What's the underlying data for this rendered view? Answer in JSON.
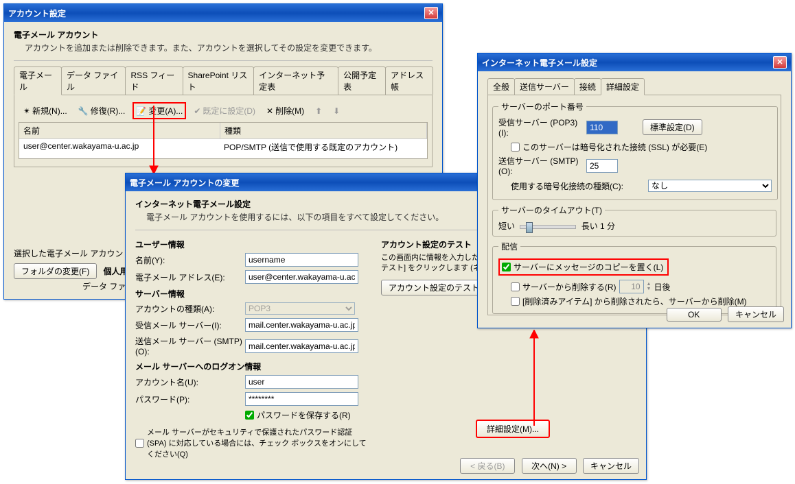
{
  "win1": {
    "title": "アカウント設定",
    "header": "電子メール アカウント",
    "sub": "アカウントを追加または削除できます。また、アカウントを選択してその設定を変更できます。",
    "tabs": [
      "電子メール",
      "データ ファイル",
      "RSS フィード",
      "SharePoint リスト",
      "インターネット予定表",
      "公開予定表",
      "アドレス帳"
    ],
    "toolbar": {
      "new": "新規(N)...",
      "repair": "修復(R)...",
      "change": "変更(A)...",
      "default": "既定に設定(D)",
      "remove": "削除(M)"
    },
    "cols": [
      "名前",
      "種類"
    ],
    "row": {
      "name": "user@center.wakayama-u.ac.jp",
      "type": "POP/SMTP (送信で使用する既定のアカウント)"
    },
    "selectedText": "選択した電子メール アカウントでは",
    "folderBtn": "フォルダの変更(F)",
    "personal": "個人用フ",
    "dataFile": "データ ファ"
  },
  "win2": {
    "title": "電子メール アカウントの変更",
    "header": "インターネット電子メール設定",
    "sub": "電子メール アカウントを使用するには、以下の項目をすべて設定してください。",
    "secUser": "ユーザー情報",
    "nameLbl": "名前(Y):",
    "nameVal": "username",
    "emailLbl": "電子メール アドレス(E):",
    "emailVal": "user@center.wakayama-u.ac",
    "secServer": "サーバー情報",
    "acctTypeLbl": "アカウントの種類(A):",
    "acctTypeVal": "POP3",
    "inSrvLbl": "受信メール サーバー(I):",
    "inSrvVal": "mail.center.wakayama-u.ac.jp",
    "outSrvLbl": "送信メール サーバー (SMTP)(O):",
    "outSrvVal": "mail.center.wakayama-u.ac.jp",
    "secLogon": "メール サーバーへのログオン情報",
    "userLbl": "アカウント名(U):",
    "userVal": "user",
    "pwLbl": "パスワード(P):",
    "pwVal": "********",
    "savePw": "パスワードを保存する(R)",
    "spa": "メール サーバーがセキュリティで保護されたパスワード認証 (SPA) に対応している場合には、チェック ボックスをオンにしてください(Q)",
    "testHeader": "アカウント設定のテスト",
    "testText": "この画面内に情報を入力したら、ことをお勧めします。テストを実行定のテスト] をクリックします (ネッ必要があります)。",
    "testBtn": "アカウント設定のテスト(T)",
    "advBtn": "詳細設定(M)...",
    "back": "< 戻る(B)",
    "next": "次へ(N) >",
    "cancel": "キャンセル"
  },
  "win3": {
    "title": "インターネット電子メール設定",
    "tabs": [
      "全般",
      "送信サーバー",
      "接続",
      "詳細設定"
    ],
    "portSec": "サーバーのポート番号",
    "pop3Lbl": "受信サーバー (POP3)(I):",
    "pop3Val": "110",
    "stdBtn": "標準設定(D)",
    "sslChk": "このサーバーは暗号化された接続 (SSL) が必要(E)",
    "smtpLbl": "送信サーバー (SMTP)(O):",
    "smtpVal": "25",
    "encLbl": "使用する暗号化接続の種類(C):",
    "encVal": "なし",
    "timeoutSec": "サーバーのタイムアウト(T)",
    "short": "短い",
    "long": "長い 1 分",
    "delivSec": "配信",
    "leaveCopy": "サーバーにメッセージのコピーを置く(L)",
    "removeAfter": "サーバーから削除する(R)",
    "daysVal": "10",
    "daysLbl": "日後",
    "removeDeleted": "[削除済みアイテム] から削除されたら、サーバーから削除(M)",
    "ok": "OK",
    "cancel": "キャンセル"
  }
}
